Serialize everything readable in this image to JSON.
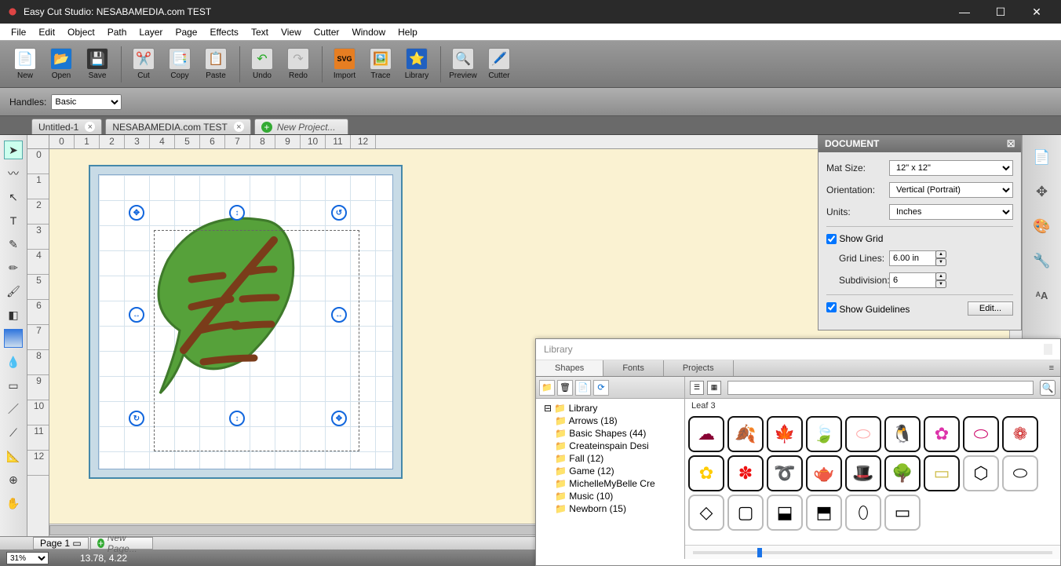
{
  "app": {
    "title": "Easy Cut Studio: NESABAMEDIA.com TEST"
  },
  "menu": [
    "File",
    "Edit",
    "Object",
    "Path",
    "Layer",
    "Page",
    "Effects",
    "Text",
    "View",
    "Cutter",
    "Window",
    "Help"
  ],
  "toolbar": {
    "new": "New",
    "open": "Open",
    "save": "Save",
    "cut": "Cut",
    "copy": "Copy",
    "paste": "Paste",
    "undo": "Undo",
    "redo": "Redo",
    "import": "Import",
    "trace": "Trace",
    "library": "Library",
    "preview": "Preview",
    "cutter": "Cutter"
  },
  "handles": {
    "label": "Handles:",
    "value": "Basic"
  },
  "tabs": {
    "t1": "Untitled-1",
    "t2": "NESABAMEDIA.com TEST",
    "new": "New Project..."
  },
  "document": {
    "title": "DOCUMENT",
    "matsize_label": "Mat Size:",
    "matsize": "12\" x 12\"",
    "orientation_label": "Orientation:",
    "orientation": "Vertical (Portrait)",
    "units_label": "Units:",
    "units": "Inches",
    "showgrid": "Show Grid",
    "gridlines_label": "Grid Lines:",
    "gridlines": "6.00 in",
    "subdiv_label": "Subdivision:",
    "subdiv": "6",
    "showguides": "Show Guidelines",
    "edit": "Edit..."
  },
  "library": {
    "title": "Library",
    "tabs": {
      "shapes": "Shapes",
      "fonts": "Fonts",
      "projects": "Projects"
    },
    "root": "Library",
    "folders": [
      "Arrows (18)",
      "Basic Shapes (44)",
      "Createinspain Desi",
      "Fall (12)",
      "Game (12)",
      "MichelleMyBelle Cre",
      "Music (10)",
      "Newborn (15)"
    ],
    "selected": "Leaf 3"
  },
  "pager": {
    "page": "Page 1",
    "new": "New Page..."
  },
  "status": {
    "zoom": "31%",
    "coords": "13.78, 4.22"
  }
}
